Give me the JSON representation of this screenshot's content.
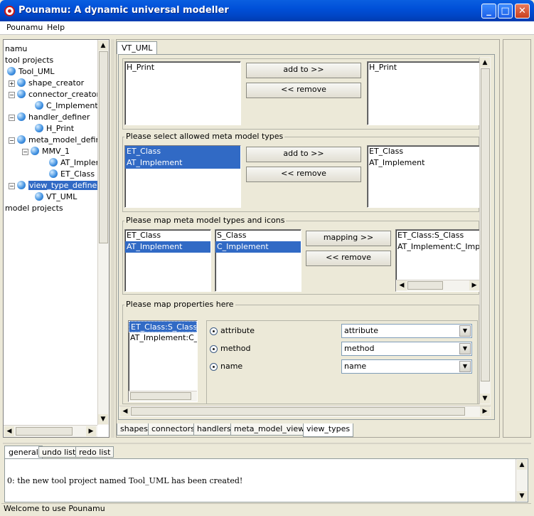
{
  "window": {
    "title": "Pounamu: A dynamic universal modeller",
    "min": "_",
    "max": "□",
    "close": "✕"
  },
  "menu": [
    "Pounamu",
    "Help"
  ],
  "tree": {
    "root": "namu",
    "tool_projects": "tool projects",
    "tool_uml": "Tool_UML",
    "shape_creator": "shape_creator",
    "connector_creator": "connector_creator",
    "c_implement": "C_Implement",
    "handler_definer": "handler_definer",
    "h_print": "H_Print",
    "meta_model_definer": "meta_model_definer",
    "mmv_1": "MMV_1",
    "at_implement": "AT_Implement",
    "et_class": "ET_Class",
    "view_type_definer": "view_type_definer",
    "vt_uml": "VT_UML",
    "model_projects": "model projects"
  },
  "editor_tab": "VT_UML",
  "section_handlers": {
    "left_items": [
      "H_Print"
    ],
    "right_items": [
      "H_Print"
    ],
    "add_button": "add to >>",
    "remove_button": "<< remove"
  },
  "section_types": {
    "title": "Please select allowed meta model types",
    "left_items": [
      "ET_Class",
      "AT_Implement"
    ],
    "right_items": [
      "ET_Class",
      "AT_Implement"
    ],
    "add_button": "add to >>",
    "remove_button": "<< remove"
  },
  "section_icons": {
    "title": "Please map meta model types and icons",
    "types": [
      "ET_Class",
      "AT_Implement"
    ],
    "icons": [
      "S_Class",
      "C_Implement"
    ],
    "mappings": [
      "ET_Class:S_Class",
      "AT_Implement:C_Implement"
    ],
    "mapping_button": "mapping >>",
    "remove_button": "<< remove"
  },
  "section_properties": {
    "title": "Please map properties here",
    "list": [
      "ET_Class:S_Class",
      "AT_Implement:C_Implement"
    ],
    "rows": [
      {
        "label": "attribute",
        "value": "attribute"
      },
      {
        "label": "method",
        "value": "method"
      },
      {
        "label": "name",
        "value": "name"
      }
    ]
  },
  "bottom_tabs": [
    "shapes",
    "connectors",
    "handlers",
    "meta_model_views",
    "view_types"
  ],
  "console_tabs": [
    "general",
    "undo list",
    "redo list"
  ],
  "console_message": "0: the new tool project named Tool_UML has been created!",
  "status": "Welcome to use Pounamu",
  "arrows": {
    "up": "▲",
    "down": "▼",
    "left": "◀",
    "right": "▶"
  }
}
